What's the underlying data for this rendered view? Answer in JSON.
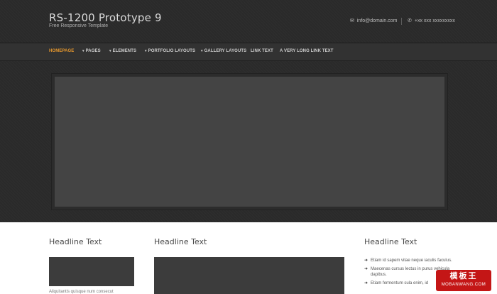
{
  "header": {
    "title": "RS-1200 Prototype 9",
    "tagline": "Free Responsive Template",
    "email": "info@domain.com",
    "phone": "+xx xxx xxxxxxxxx"
  },
  "nav": {
    "items": [
      {
        "label": "HOMEPAGE",
        "active": true,
        "dropdown": false
      },
      {
        "label": "PAGES",
        "active": false,
        "dropdown": true
      },
      {
        "label": "ELEMENTS",
        "active": false,
        "dropdown": true
      },
      {
        "label": "PORTFOLIO LAYOUTS",
        "active": false,
        "dropdown": true
      },
      {
        "label": "GALLERY LAYOUTS",
        "active": false,
        "dropdown": true
      },
      {
        "label": "LINK TEXT",
        "active": false,
        "dropdown": false
      },
      {
        "label": "A VERY LONG LINK TEXT",
        "active": false,
        "dropdown": false
      }
    ],
    "caret": "▾"
  },
  "columns": [
    {
      "headline": "Headline Text",
      "excerpt": "Aliquitantis quisque num consecut"
    },
    {
      "headline": "Headline Text"
    },
    {
      "headline": "Headline Text",
      "list": [
        "Etiam id sapem vitae neque iaculis faculus.",
        "Maecenas cursus lectus in purus vehicula dapibus.",
        "Etiam fermentum sula enim, id"
      ]
    }
  ],
  "icons": {
    "email": "mail-icon",
    "phone": "phone-icon",
    "list_bullet": "arrow-right-icon"
  },
  "colors": {
    "accent": "#e3962e",
    "header_bg": "#2a2a2a",
    "nav_bg": "#323232",
    "slider": "#444444",
    "watermark": "#c41616"
  },
  "watermark": {
    "main": "模板王",
    "sub": "MOBANWANG.COM"
  }
}
